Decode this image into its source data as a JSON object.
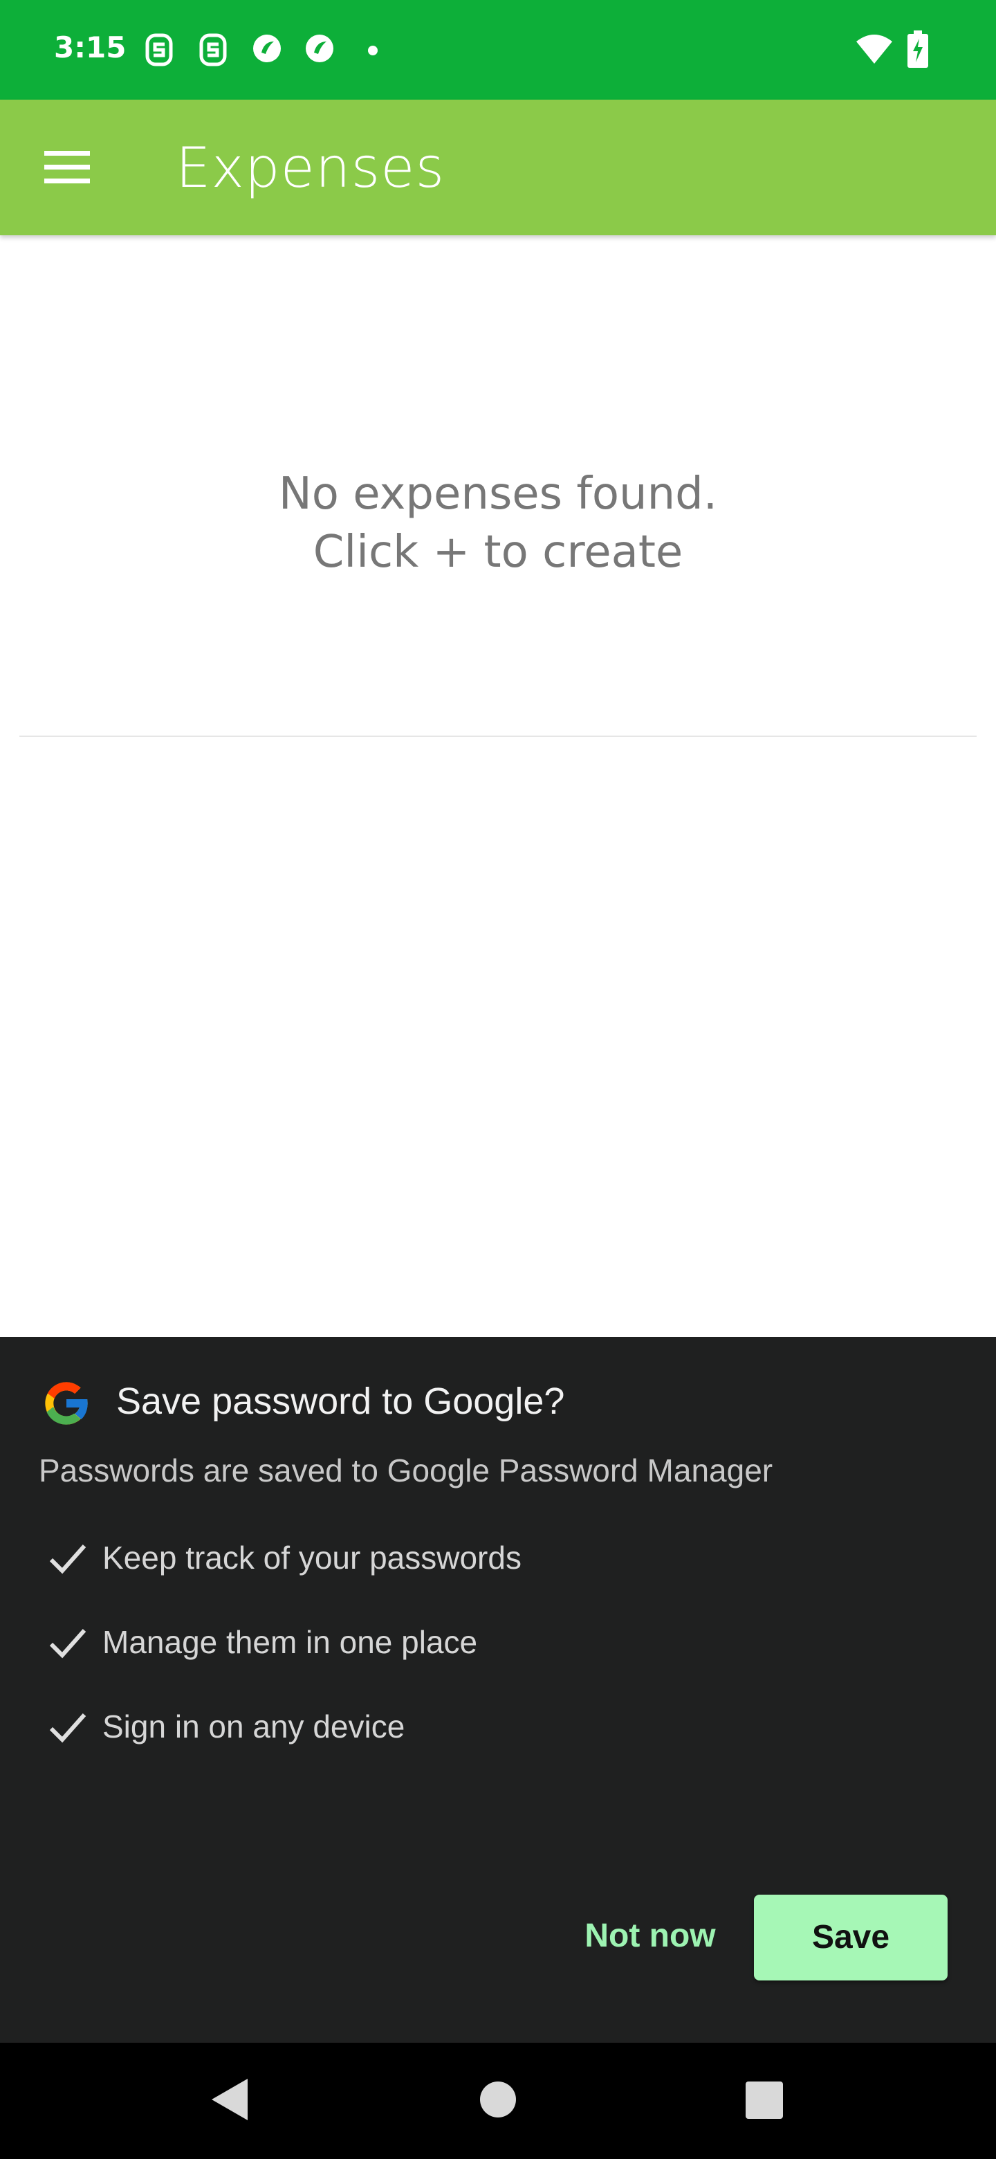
{
  "status_bar": {
    "time": "3:15",
    "notification_icons": [
      "s-icon",
      "s-icon",
      "nuvolo-icon",
      "nuvolo-icon",
      "dot-icon"
    ],
    "system_icons": [
      "wifi-icon",
      "battery-charging-icon"
    ]
  },
  "app_bar": {
    "title": "Expenses",
    "menu_icon": "menu-icon",
    "color": "#8bca49"
  },
  "main": {
    "empty_line1": "No expenses found.",
    "empty_line2": "Click + to create"
  },
  "save_password_sheet": {
    "logo": "google-icon",
    "title": "Save password to Google?",
    "subtitle": "Passwords are saved to Google Password Manager",
    "features": [
      "Keep track of your passwords",
      "Manage them in one place",
      "Sign in on any device"
    ],
    "not_now_label": "Not now",
    "save_label": "Save",
    "accent": "#a6f7b6"
  },
  "nav_bar": {
    "icons": [
      "back-icon",
      "home-icon",
      "recents-icon"
    ]
  }
}
